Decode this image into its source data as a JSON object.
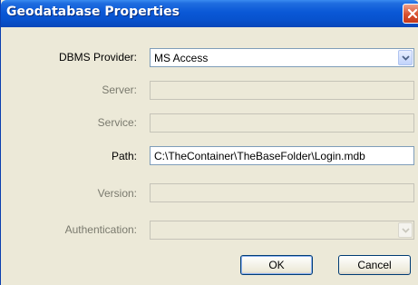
{
  "window": {
    "title": "Geodatabase Properties"
  },
  "fields": {
    "dbms_provider": {
      "label": "DBMS Provider:",
      "value": "MS Access"
    },
    "server": {
      "label": "Server:",
      "value": ""
    },
    "service": {
      "label": "Service:",
      "value": ""
    },
    "path": {
      "label": "Path:",
      "value": "C:\\TheContainer\\TheBaseFolder\\Login.mdb"
    },
    "version": {
      "label": "Version:",
      "value": ""
    },
    "authentication": {
      "label": "Authentication:",
      "value": ""
    }
  },
  "buttons": {
    "ok": "OK",
    "cancel": "Cancel"
  }
}
